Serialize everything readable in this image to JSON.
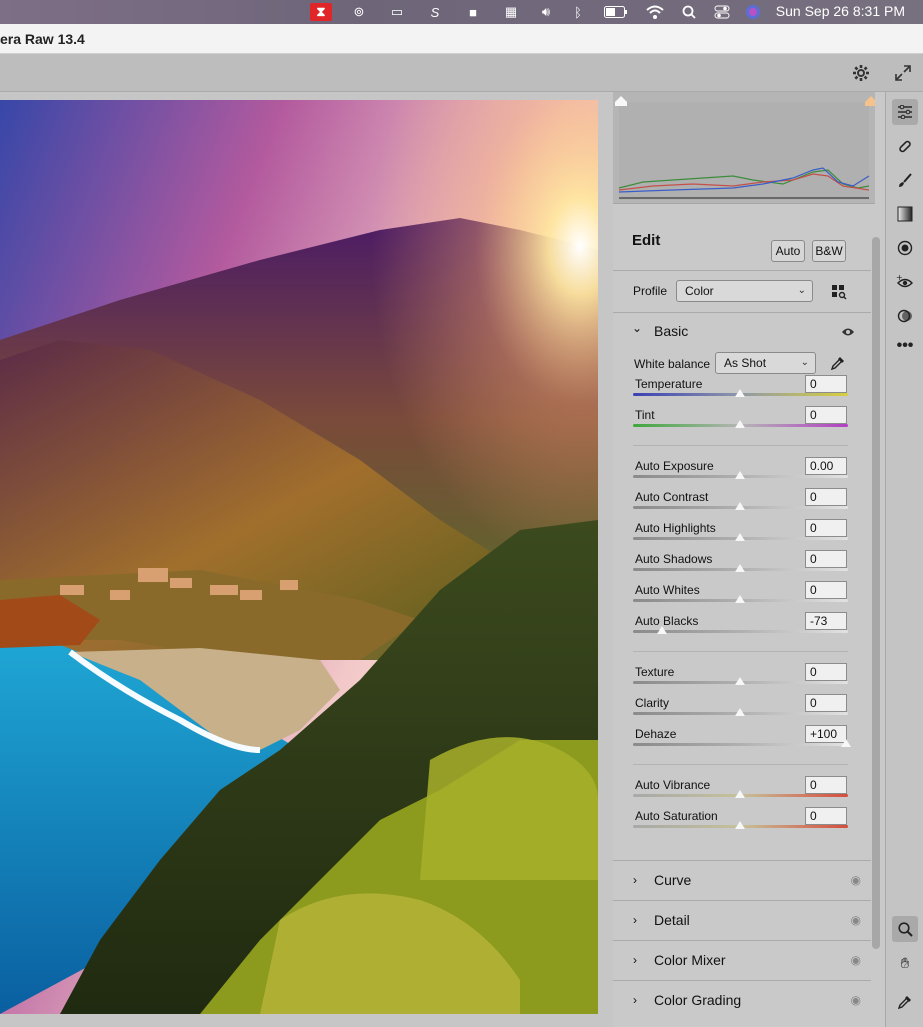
{
  "menubar": {
    "clock": "Sun Sep 26  8:31 PM",
    "icons": [
      "app-red-icon",
      "creative-cloud-icon",
      "screen-icon",
      "script-s-icon",
      "video-icon",
      "calendar-icon",
      "volume-icon",
      "bluetooth-icon",
      "battery-icon",
      "wifi-icon",
      "search-icon",
      "control-center-icon",
      "siri-icon"
    ]
  },
  "window": {
    "title": "era Raw 13.4"
  },
  "edit": {
    "title": "Edit",
    "auto_label": "Auto",
    "bw_label": "B&W",
    "profile_label": "Profile",
    "profile_value": "Color"
  },
  "basic": {
    "title": "Basic",
    "white_balance_label": "White balance",
    "white_balance_value": "As Shot",
    "sliders": [
      {
        "name": "Temperature",
        "value": "0",
        "pos": 0.5
      },
      {
        "name": "Tint",
        "value": "0",
        "pos": 0.5
      },
      {
        "name": "Auto Exposure",
        "value": "0.00",
        "pos": 0.5
      },
      {
        "name": "Auto Contrast",
        "value": "0",
        "pos": 0.5
      },
      {
        "name": "Auto Highlights",
        "value": "0",
        "pos": 0.5
      },
      {
        "name": "Auto Shadows",
        "value": "0",
        "pos": 0.5
      },
      {
        "name": "Auto Whites",
        "value": "0",
        "pos": 0.5
      },
      {
        "name": "Auto Blacks",
        "value": "-73",
        "pos": 0.135
      },
      {
        "name": "Texture",
        "value": "0",
        "pos": 0.5
      },
      {
        "name": "Clarity",
        "value": "0",
        "pos": 0.5
      },
      {
        "name": "Dehaze",
        "value": "+100",
        "pos": 1.0
      },
      {
        "name": "Auto Vibrance",
        "value": "0",
        "pos": 0.5
      },
      {
        "name": "Auto Saturation",
        "value": "0",
        "pos": 0.5
      }
    ]
  },
  "sections": [
    {
      "title": "Curve"
    },
    {
      "title": "Detail"
    },
    {
      "title": "Color Mixer"
    },
    {
      "title": "Color Grading"
    }
  ],
  "tools": [
    "edit-sliders-icon",
    "healing-icon",
    "brush-icon",
    "linear-gradient-icon",
    "radial-gradient-icon",
    "red-eye-icon",
    "presets-icon",
    "more-icon",
    "zoom-icon",
    "hand-icon",
    "color-sampler-icon"
  ],
  "colors": {
    "panel": "#c9c9c9",
    "accent_eye": "#333333"
  }
}
